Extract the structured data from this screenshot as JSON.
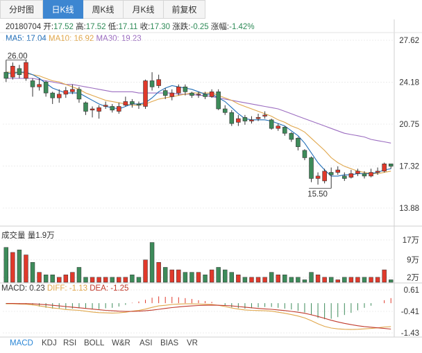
{
  "tabs": [
    "分时图",
    "日K线",
    "周K线",
    "月K线",
    "前复权"
  ],
  "active_tab": 1,
  "info": {
    "date": "20180704",
    "open_label": "开:",
    "open": "17.52",
    "high_label": "高:",
    "high": "17.52",
    "low_label": "低:",
    "low": "17.11",
    "close_label": "收:",
    "close": "17.30",
    "change_label": "涨跌:",
    "change": "-0.25",
    "pct_label": "涨幅:",
    "pct": "-1.42%"
  },
  "ma_legend": {
    "ma5": "MA5: 17.04",
    "ma10": "MA10: 16.92",
    "ma30": "MA30: 19.23"
  },
  "colors": {
    "up": "#e0392b",
    "down": "#3d8b5a",
    "ma5": "#1f6db7",
    "ma10": "#e0a64a",
    "ma30": "#9b6cc0",
    "active_tab": "#3d86d1"
  },
  "volume_label": "成交量 量1.9万",
  "macd_label": {
    "macd": "MACD: 0.23",
    "diff": "DIFF: -1.13",
    "dea": "DEA: -1.25"
  },
  "bottom_tabs": [
    "MACD",
    "KDJ",
    "RSI",
    "BOLL",
    "W&R",
    "ASI",
    "BIAS",
    "VR"
  ],
  "chart_data": {
    "type": "candlestick",
    "price_axis": {
      "ticks": [
        "27.62",
        "24.18",
        "20.75",
        "17.32",
        "13.88"
      ],
      "ylim": [
        13.88,
        27.62
      ]
    },
    "volume_axis": {
      "ticks": [
        "17万",
        "9万",
        "2万"
      ],
      "ylim": [
        0,
        17
      ]
    },
    "macd_axis": {
      "ticks": [
        "0.61",
        "-0.41",
        "-1.43"
      ],
      "ylim": [
        -1.43,
        0.61
      ]
    },
    "annotations": {
      "high": "26.00",
      "low": "15.50"
    },
    "candles": [
      {
        "o": 25.0,
        "c": 24.5,
        "h": 26.0,
        "l": 24.2
      },
      {
        "o": 24.6,
        "c": 25.5,
        "h": 25.8,
        "l": 24.4
      },
      {
        "o": 25.3,
        "c": 24.8,
        "h": 25.6,
        "l": 24.5
      },
      {
        "o": 24.5,
        "c": 25.8,
        "h": 26.0,
        "l": 24.3
      },
      {
        "o": 24.3,
        "c": 23.8,
        "h": 24.5,
        "l": 23.0
      },
      {
        "o": 23.8,
        "c": 24.0,
        "h": 24.5,
        "l": 23.5
      },
      {
        "o": 24.2,
        "c": 23.3,
        "h": 24.3,
        "l": 23.0
      },
      {
        "o": 23.3,
        "c": 22.9,
        "h": 23.4,
        "l": 22.4
      },
      {
        "o": 22.9,
        "c": 23.2,
        "h": 23.6,
        "l": 22.5
      },
      {
        "o": 23.2,
        "c": 23.5,
        "h": 23.8,
        "l": 22.9
      },
      {
        "o": 23.4,
        "c": 23.6,
        "h": 24.0,
        "l": 23.2
      },
      {
        "o": 23.6,
        "c": 22.8,
        "h": 23.8,
        "l": 22.5
      },
      {
        "o": 22.5,
        "c": 21.8,
        "h": 22.6,
        "l": 21.5
      },
      {
        "o": 21.9,
        "c": 22.0,
        "h": 22.2,
        "l": 21.3
      },
      {
        "o": 21.8,
        "c": 22.1,
        "h": 22.3,
        "l": 21.2
      },
      {
        "o": 22.2,
        "c": 22.3,
        "h": 22.6,
        "l": 22.0
      },
      {
        "o": 22.2,
        "c": 21.9,
        "h": 22.4,
        "l": 21.7
      },
      {
        "o": 21.8,
        "c": 22.2,
        "h": 22.5,
        "l": 21.6
      },
      {
        "o": 22.3,
        "c": 22.6,
        "h": 23.0,
        "l": 22.2
      },
      {
        "o": 22.6,
        "c": 22.4,
        "h": 22.8,
        "l": 22.1
      },
      {
        "o": 22.4,
        "c": 22.3,
        "h": 22.6,
        "l": 22.0
      },
      {
        "o": 22.2,
        "c": 24.3,
        "h": 24.4,
        "l": 22.0
      },
      {
        "o": 24.3,
        "c": 23.8,
        "h": 25.0,
        "l": 23.5
      },
      {
        "o": 23.9,
        "c": 24.4,
        "h": 24.8,
        "l": 23.7
      },
      {
        "o": 23.5,
        "c": 23.1,
        "h": 23.7,
        "l": 22.8
      },
      {
        "o": 23.0,
        "c": 23.3,
        "h": 23.6,
        "l": 22.7
      },
      {
        "o": 23.3,
        "c": 23.8,
        "h": 24.0,
        "l": 23.1
      },
      {
        "o": 23.8,
        "c": 23.4,
        "h": 24.0,
        "l": 23.1
      },
      {
        "o": 23.3,
        "c": 23.1,
        "h": 23.4,
        "l": 22.9
      },
      {
        "o": 23.2,
        "c": 23.2,
        "h": 23.4,
        "l": 22.9
      },
      {
        "o": 23.2,
        "c": 23.0,
        "h": 23.4,
        "l": 22.8
      },
      {
        "o": 23.0,
        "c": 23.4,
        "h": 23.6,
        "l": 22.9
      },
      {
        "o": 23.4,
        "c": 22.0,
        "h": 23.6,
        "l": 21.9
      },
      {
        "o": 22.0,
        "c": 21.7,
        "h": 22.3,
        "l": 21.5
      },
      {
        "o": 21.7,
        "c": 20.8,
        "h": 21.9,
        "l": 20.6
      },
      {
        "o": 20.9,
        "c": 21.2,
        "h": 21.5,
        "l": 20.6
      },
      {
        "o": 21.3,
        "c": 21.0,
        "h": 21.5,
        "l": 20.7
      },
      {
        "o": 21.0,
        "c": 21.1,
        "h": 21.4,
        "l": 20.8
      },
      {
        "o": 21.2,
        "c": 21.3,
        "h": 21.6,
        "l": 21.0
      },
      {
        "o": 21.4,
        "c": 21.5,
        "h": 21.8,
        "l": 21.2
      },
      {
        "o": 21.1,
        "c": 20.4,
        "h": 21.2,
        "l": 20.3
      },
      {
        "o": 20.4,
        "c": 20.6,
        "h": 20.8,
        "l": 20.2
      },
      {
        "o": 20.5,
        "c": 20.0,
        "h": 20.6,
        "l": 19.8
      },
      {
        "o": 20.0,
        "c": 19.5,
        "h": 20.1,
        "l": 19.3
      },
      {
        "o": 19.6,
        "c": 18.9,
        "h": 19.7,
        "l": 18.6
      },
      {
        "o": 18.6,
        "c": 18.0,
        "h": 18.7,
        "l": 17.8
      },
      {
        "o": 18.0,
        "c": 16.3,
        "h": 18.1,
        "l": 16.0
      },
      {
        "o": 16.3,
        "c": 16.5,
        "h": 16.8,
        "l": 15.8
      },
      {
        "o": 16.1,
        "c": 16.9,
        "h": 17.1,
        "l": 15.9
      },
      {
        "o": 16.8,
        "c": 16.6,
        "h": 17.2,
        "l": 15.5
      },
      {
        "o": 16.8,
        "c": 17.0,
        "h": 17.3,
        "l": 16.6
      },
      {
        "o": 16.5,
        "c": 16.3,
        "h": 16.8,
        "l": 16.1
      },
      {
        "o": 16.4,
        "c": 16.7,
        "h": 17.0,
        "l": 16.3
      },
      {
        "o": 16.7,
        "c": 16.9,
        "h": 17.1,
        "l": 16.5
      },
      {
        "o": 16.7,
        "c": 16.5,
        "h": 16.9,
        "l": 16.3
      },
      {
        "o": 16.5,
        "c": 16.8,
        "h": 17.1,
        "l": 16.4
      },
      {
        "o": 16.8,
        "c": 16.9,
        "h": 17.2,
        "l": 16.6
      },
      {
        "o": 16.9,
        "c": 17.5,
        "h": 17.6,
        "l": 16.8
      },
      {
        "o": 17.5,
        "c": 17.3,
        "h": 17.5,
        "l": 17.1
      }
    ],
    "ma5": [
      24.9,
      24.9,
      25.0,
      25.0,
      24.8,
      24.5,
      24.1,
      23.7,
      23.5,
      23.3,
      23.3,
      23.3,
      23.0,
      22.7,
      22.4,
      22.2,
      22.1,
      22.0,
      22.2,
      22.4,
      22.4,
      22.5,
      22.9,
      23.4,
      23.7,
      23.9,
      23.8,
      23.7,
      23.6,
      23.4,
      23.2,
      23.2,
      22.9,
      22.6,
      22.1,
      21.6,
      21.2,
      21.1,
      21.1,
      21.1,
      21.0,
      20.8,
      20.6,
      20.2,
      19.8,
      19.2,
      18.4,
      17.6,
      17.0,
      16.5,
      16.5,
      16.6,
      16.6,
      16.7,
      16.7,
      16.7,
      16.8,
      17.0,
      17.1
    ],
    "ma10": [
      25.0,
      25.0,
      25.0,
      24.9,
      24.8,
      24.7,
      24.5,
      24.3,
      24.2,
      24.0,
      23.8,
      23.6,
      23.3,
      23.1,
      22.9,
      22.7,
      22.6,
      22.5,
      22.4,
      22.3,
      22.3,
      22.4,
      22.6,
      22.8,
      22.9,
      23.0,
      23.1,
      23.2,
      23.3,
      23.3,
      23.3,
      23.3,
      23.1,
      22.9,
      22.7,
      22.4,
      22.2,
      22.0,
      21.8,
      21.6,
      21.4,
      21.1,
      20.9,
      20.6,
      20.4,
      20.1,
      19.6,
      19.1,
      18.6,
      18.0,
      17.6,
      17.3,
      17.1,
      16.9,
      16.8,
      16.7,
      16.7,
      16.8,
      16.9
    ],
    "ma30": [
      24.5,
      24.5,
      24.5,
      24.5,
      24.5,
      24.4,
      24.3,
      24.2,
      24.1,
      24.0,
      24.0,
      23.9,
      23.8,
      23.7,
      23.6,
      23.5,
      23.4,
      23.4,
      23.4,
      23.4,
      23.3,
      23.3,
      23.3,
      23.3,
      23.3,
      23.3,
      23.2,
      23.2,
      23.2,
      23.1,
      23.1,
      23.0,
      22.9,
      22.8,
      22.7,
      22.6,
      22.5,
      22.4,
      22.3,
      22.2,
      22.1,
      22.0,
      21.8,
      21.6,
      21.4,
      21.2,
      21.0,
      20.8,
      20.6,
      20.4,
      20.2,
      20.0,
      19.9,
      19.8,
      19.7,
      19.5,
      19.4,
      19.3,
      19.2
    ],
    "volume": [
      14,
      12,
      13,
      11,
      8,
      4,
      3,
      3,
      2,
      3,
      4,
      6,
      2,
      2,
      2,
      2,
      2,
      2,
      2,
      3,
      2,
      9,
      16,
      8,
      6,
      5,
      5,
      4,
      4,
      4,
      3,
      5,
      6,
      5,
      4,
      3,
      2,
      2,
      2,
      2,
      4,
      3,
      3,
      2,
      2,
      1,
      4,
      3,
      2,
      2,
      1,
      2,
      2,
      2,
      2,
      2,
      2,
      5,
      1
    ],
    "macd_diff": [
      -0.05,
      -0.05,
      -0.06,
      -0.07,
      -0.1,
      -0.15,
      -0.2,
      -0.25,
      -0.28,
      -0.32,
      -0.34,
      -0.36,
      -0.4,
      -0.44,
      -0.47,
      -0.48,
      -0.49,
      -0.48,
      -0.45,
      -0.4,
      -0.36,
      -0.3,
      -0.22,
      -0.15,
      -0.12,
      -0.08,
      -0.06,
      -0.05,
      -0.05,
      -0.06,
      -0.07,
      -0.08,
      -0.12,
      -0.18,
      -0.25,
      -0.3,
      -0.34,
      -0.36,
      -0.37,
      -0.38,
      -0.4,
      -0.45,
      -0.5,
      -0.56,
      -0.63,
      -0.72,
      -0.85,
      -1.0,
      -1.12,
      -1.2,
      -1.24,
      -1.26,
      -1.27,
      -1.26,
      -1.24,
      -1.22,
      -1.19,
      -1.15,
      -1.13
    ],
    "macd_dea": [
      -0.03,
      -0.03,
      -0.04,
      -0.04,
      -0.05,
      -0.07,
      -0.09,
      -0.12,
      -0.15,
      -0.18,
      -0.21,
      -0.24,
      -0.27,
      -0.3,
      -0.33,
      -0.36,
      -0.38,
      -0.4,
      -0.41,
      -0.41,
      -0.4,
      -0.38,
      -0.35,
      -0.31,
      -0.27,
      -0.23,
      -0.2,
      -0.17,
      -0.15,
      -0.13,
      -0.12,
      -0.11,
      -0.12,
      -0.13,
      -0.15,
      -0.18,
      -0.21,
      -0.24,
      -0.27,
      -0.29,
      -0.31,
      -0.34,
      -0.37,
      -0.41,
      -0.45,
      -0.5,
      -0.57,
      -0.65,
      -0.74,
      -0.83,
      -0.91,
      -0.98,
      -1.04,
      -1.09,
      -1.13,
      -1.16,
      -1.19,
      -1.22,
      -1.25
    ]
  }
}
